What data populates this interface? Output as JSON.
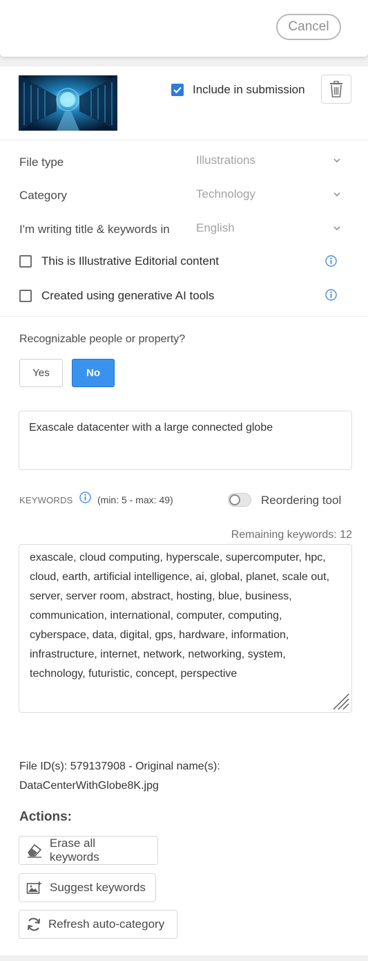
{
  "header": {
    "cancel_label": "Cancel"
  },
  "asset": {
    "include_label": "Include in submission",
    "include_checked": true
  },
  "fields": {
    "file_type": {
      "label": "File type",
      "value": "Illustrations"
    },
    "category": {
      "label": "Category",
      "value": "Technology"
    },
    "language": {
      "label": "I'm writing title & keywords in",
      "value": "English"
    },
    "editorial": {
      "label": "This is Illustrative Editorial content",
      "checked": false
    },
    "generative_ai": {
      "label": "Created using generative AI tools",
      "checked": false
    }
  },
  "recognizable": {
    "question": "Recognizable people or property?",
    "yes_label": "Yes",
    "no_label": "No",
    "selected": "No"
  },
  "title": {
    "value": "Exascale datacenter with a large connected globe"
  },
  "keywords": {
    "heading": "KEYWORDS",
    "limits": "(min: 5 - max: 49)",
    "reorder_label": "Reordering tool",
    "reorder_on": false,
    "remaining": "Remaining keywords: 12",
    "value": "exascale, cloud computing, hyperscale, supercomputer, hpc, cloud, earth, artificial intelligence, ai, global, planet, scale out, server, server room, abstract, hosting, blue, business, communication, international, computer, computing, cyberspace, data, digital, gps, hardware, information, infrastructure, internet, network, networking, system, technology, futuristic, concept, perspective"
  },
  "file_info": {
    "line1": "File ID(s): 579137908 - Original name(s):",
    "line2": "DataCenterWithGlobe8K.jpg"
  },
  "actions": {
    "heading": "Actions:",
    "erase_label": "Erase all keywords",
    "suggest_label": "Suggest keywords",
    "refresh_label": "Refresh auto-category"
  },
  "colors": {
    "accent": "#2d7be3",
    "info": "#3a86e0"
  }
}
